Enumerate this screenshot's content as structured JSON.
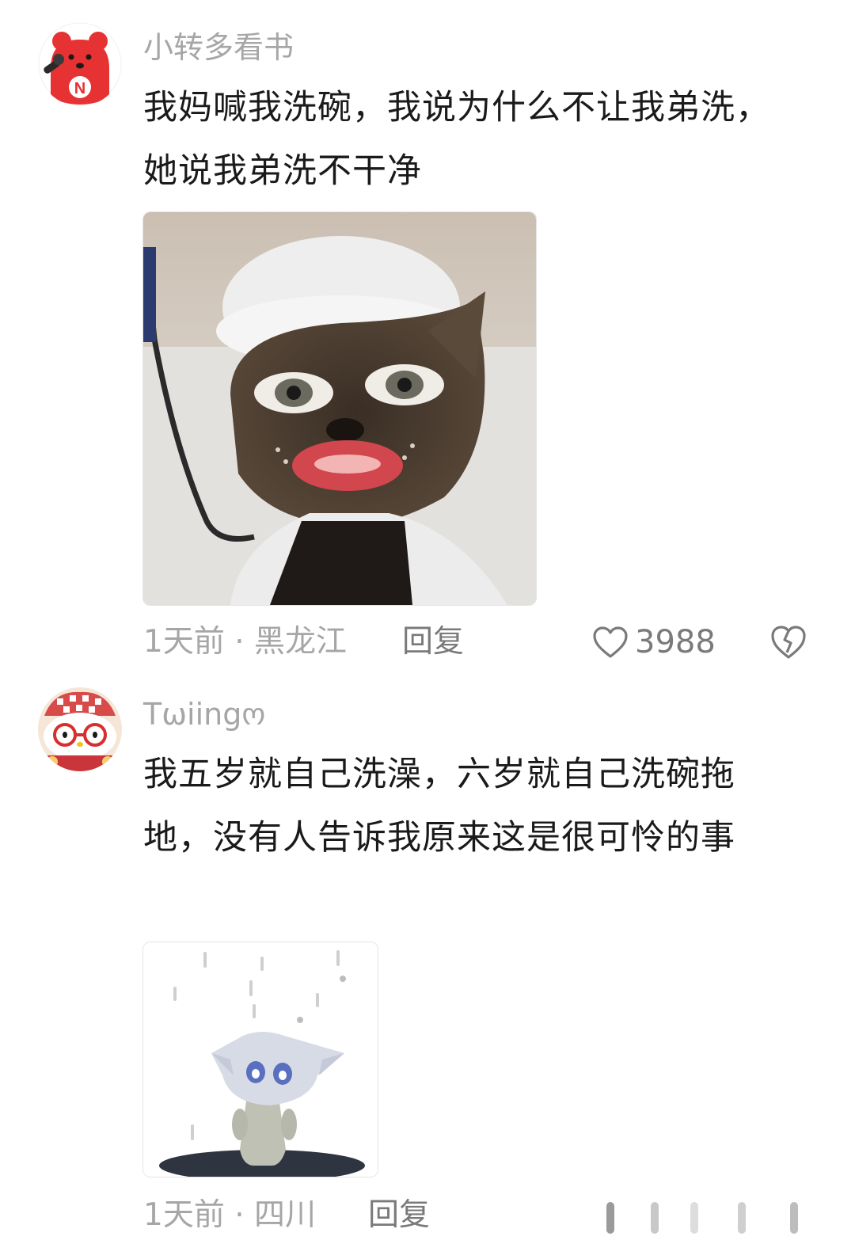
{
  "comments": [
    {
      "username": "小转多看书",
      "avatar_icon": "red-bear-mascot-avatar",
      "text": "我妈喊我洗碗，我说为什么不让我弟洗，她说我弟洗不干净",
      "image_icon": "cat-with-makeup-meme",
      "meta": "1天前 · 黑龙江",
      "reply_label": "回复",
      "like_count": "3988"
    },
    {
      "username": "Tωiingო",
      "avatar_icon": "hello-kitty-glasses-avatar",
      "text": "我五岁就自己洗澡，六岁就自己洗碗拖地，没有人告诉我原来这是很可怜的事",
      "image_icon": "crying-cat-in-rain-meme",
      "meta": "1天前 · 四川",
      "reply_label": "回复"
    }
  ],
  "colors": {
    "meta_text": "#a6a6a6",
    "action_text": "#7a7a7a",
    "body_text": "#1a1a1a",
    "avatar_red": "#e63232"
  }
}
